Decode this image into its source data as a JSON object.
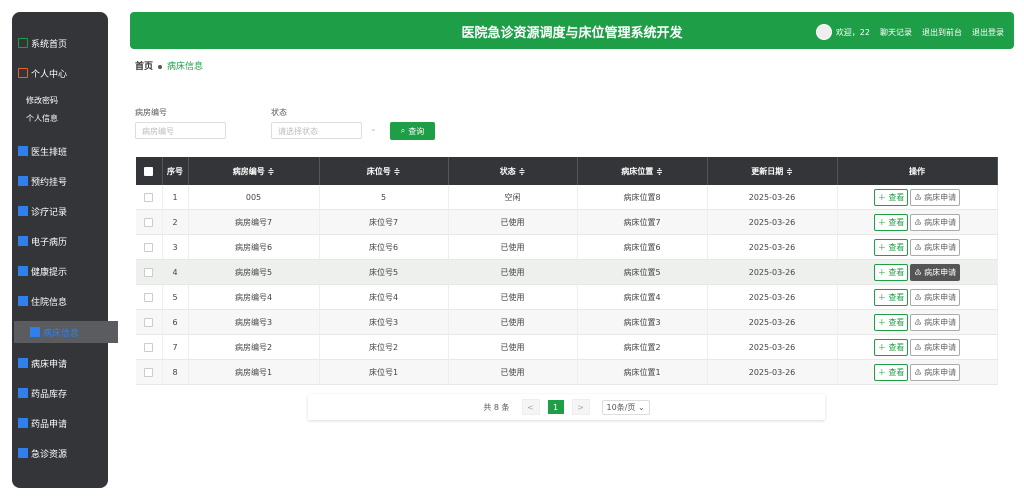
{
  "sidebar": {
    "items": [
      {
        "label": "系统首页",
        "icon": "home-icon",
        "color": "#1e9e47"
      },
      {
        "label": "个人中心",
        "icon": "wallet-icon",
        "color": "#e8612c"
      },
      {
        "label": "医生排班",
        "icon": "list-icon",
        "color": "#2f80ed"
      },
      {
        "label": "预约挂号",
        "icon": "clipboard-icon",
        "color": "#2f80ed"
      },
      {
        "label": "诊疗记录",
        "icon": "grid-icon",
        "color": "#2f80ed"
      },
      {
        "label": "电子病历",
        "icon": "grid-icon",
        "color": "#2f80ed"
      },
      {
        "label": "健康提示",
        "icon": "check-icon",
        "color": "#2f80ed"
      },
      {
        "label": "住院信息",
        "icon": "monitor-icon",
        "color": "#2f80ed"
      },
      {
        "label": "病床信息",
        "icon": "grid-icon",
        "color": "#2f80ed"
      },
      {
        "label": "病床申请",
        "icon": "grid-icon",
        "color": "#2f80ed"
      },
      {
        "label": "药品库存",
        "icon": "grid-icon",
        "color": "#2f80ed"
      },
      {
        "label": "药品申请",
        "icon": "grid-icon",
        "color": "#2f80ed"
      },
      {
        "label": "急诊资源",
        "icon": "chat-icon",
        "color": "#2f80ed"
      }
    ],
    "sub_items": [
      "修改密码",
      "个人信息"
    ]
  },
  "header": {
    "title": "医院急诊资源调度与床位管理系统开发",
    "welcome": "欢迎，22",
    "chat": "聊天记录",
    "backend": "退出到前台",
    "logout": "退出登录"
  },
  "breadcrumb": {
    "home": "首页",
    "current": "病床信息"
  },
  "filters": {
    "room_label": "病房编号",
    "room_placeholder": "病房编号",
    "status_label": "状态",
    "status_placeholder": "请选择状态",
    "query_label": "查询"
  },
  "table": {
    "headers": [
      "序号",
      "病房编号 ≑",
      "床位号 ≑",
      "状态 ≑",
      "病床位置 ≑",
      "更新日期 ≑",
      "操作"
    ],
    "rows": [
      {
        "no": "1",
        "room": "005",
        "bed": "5",
        "status": "空闲",
        "location": "病床位置8",
        "date": "2025-03-26"
      },
      {
        "no": "2",
        "room": "病房编号7",
        "bed": "床位号7",
        "status": "已使用",
        "location": "病床位置7",
        "date": "2025-03-26"
      },
      {
        "no": "3",
        "room": "病房编号6",
        "bed": "床位号6",
        "status": "已使用",
        "location": "病床位置6",
        "date": "2025-03-26"
      },
      {
        "no": "4",
        "room": "病房编号5",
        "bed": "床位号5",
        "status": "已使用",
        "location": "病床位置5",
        "date": "2025-03-26"
      },
      {
        "no": "5",
        "room": "病房编号4",
        "bed": "床位号4",
        "status": "已使用",
        "location": "病床位置4",
        "date": "2025-03-26"
      },
      {
        "no": "6",
        "room": "病房编号3",
        "bed": "床位号3",
        "status": "已使用",
        "location": "病床位置3",
        "date": "2025-03-26"
      },
      {
        "no": "7",
        "room": "病房编号2",
        "bed": "床位号2",
        "status": "已使用",
        "location": "病床位置2",
        "date": "2025-03-26"
      },
      {
        "no": "8",
        "room": "病房编号1",
        "bed": "床位号1",
        "status": "已使用",
        "location": "病床位置1",
        "date": "2025-03-26"
      }
    ],
    "view_label": "＋ 查看",
    "apply_label": "♳ 病床申请"
  },
  "pagination": {
    "total": "共 8 条",
    "prev": "<",
    "current": "1",
    "next": ">",
    "size": "10条/页 ⌄"
  }
}
